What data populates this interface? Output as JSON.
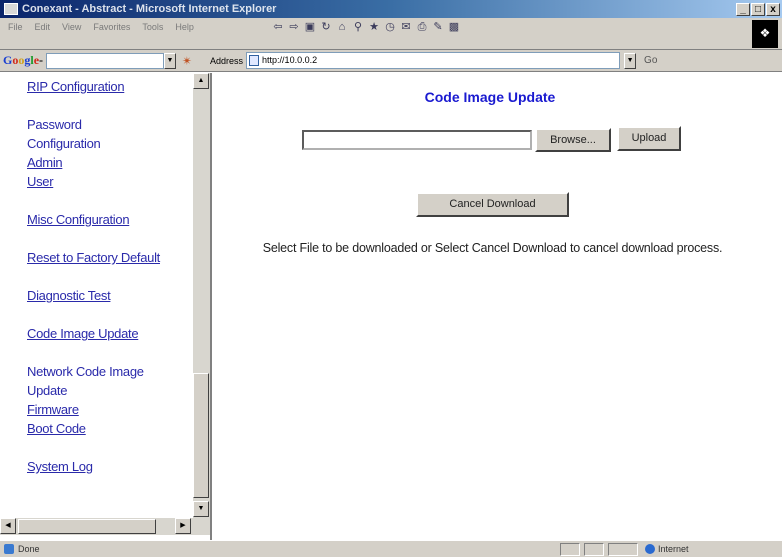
{
  "window": {
    "title": "Conexant - Abstract - Microsoft Internet Explorer",
    "controls": [
      "_",
      "□",
      "x"
    ]
  },
  "menu": [
    "File",
    "Edit",
    "View",
    "Favorites",
    "Tools",
    "Help"
  ],
  "google": {
    "logo": "Google",
    "query": ""
  },
  "address": {
    "label": "Address",
    "url": "http://10.0.0.2"
  },
  "go_label": "Go",
  "sidebar": {
    "items": [
      {
        "label": "RIP Configuration",
        "link": true
      },
      {
        "label": "Password",
        "link": false
      },
      {
        "label": "Configuration",
        "link": false
      },
      {
        "label": "Admin",
        "link": true
      },
      {
        "label": "User",
        "link": true
      },
      {
        "label": "Misc Configuration",
        "link": true
      },
      {
        "label": "Reset to Factory Default",
        "link": true
      },
      {
        "label": "Diagnostic Test",
        "link": true
      },
      {
        "label": "Code Image Update",
        "link": true
      },
      {
        "label": "Network Code Image",
        "link": false
      },
      {
        "label": "Update",
        "link": false
      },
      {
        "label": "Firmware",
        "link": true
      },
      {
        "label": "Boot Code",
        "link": true
      },
      {
        "label": "System Log",
        "link": true
      }
    ]
  },
  "main": {
    "title": "Code Image Update",
    "file_value": "",
    "browse_label": "Browse...",
    "upload_label": "Upload",
    "cancel_label": "Cancel Download",
    "instruction": "Select File to be downloaded or Select Cancel Download to cancel download process."
  },
  "status": {
    "text": "Done",
    "zone": "Internet"
  }
}
